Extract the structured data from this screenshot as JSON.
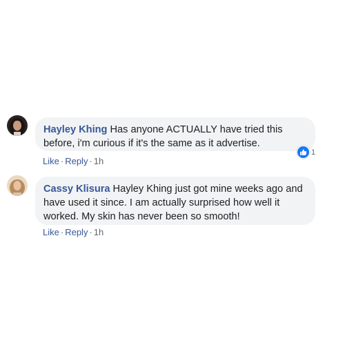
{
  "comments": [
    {
      "author": "Hayley Khing",
      "text": "Has anyone ACTUALLY have tried this before, i'm curious if it's the same as it advertise.",
      "like_label": "Like",
      "reply_label": "Reply",
      "separator": "·",
      "time": "1h",
      "reaction_count": "1",
      "avatar_icon": "user-avatar-dark-hair"
    },
    {
      "author": "Cassy Klisura",
      "text": "Hayley Khing just got mine weeks ago and have used it since. I am actually surprised how well it worked. My skin has never been so smooth!",
      "like_label": "Like",
      "reply_label": "Reply",
      "separator": "·",
      "time": "1h",
      "avatar_icon": "user-avatar-blonde-hair"
    }
  ],
  "colors": {
    "link": "#385898",
    "bubble": "#f2f3f5",
    "like_badge": "#1877f2",
    "text": "#1c1e21",
    "muted": "#606770"
  }
}
